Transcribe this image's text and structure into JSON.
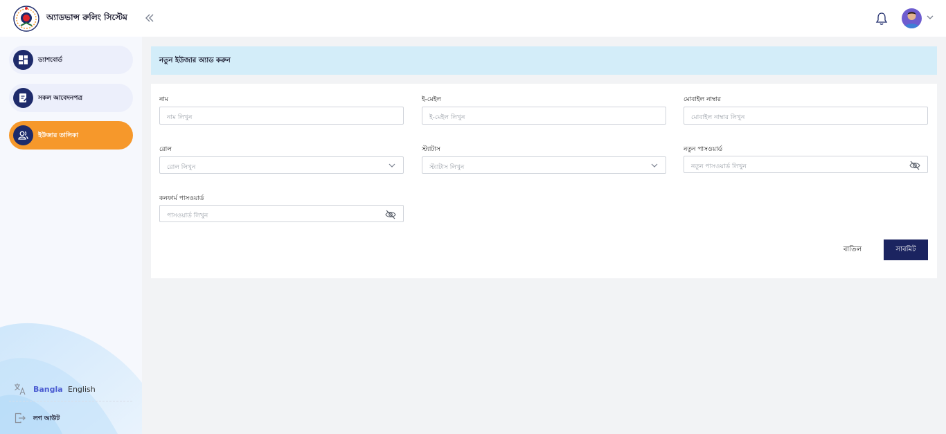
{
  "app": {
    "title": "অ্যাডভান্স রুলিং সিস্টেম"
  },
  "sidebar": {
    "items": [
      {
        "label": "ড্যাশবোর্ড",
        "icon": "dashboard-icon",
        "active": false
      },
      {
        "label": "সকল আবেদনপত্র",
        "icon": "document-edit-icon",
        "active": false
      },
      {
        "label": "ইউজার তালিকা",
        "icon": "users-icon",
        "active": true
      }
    ],
    "language": {
      "bangla": "Bangla",
      "english": "English",
      "selected": "Bangla"
    },
    "logout_label": "লগ আউট"
  },
  "page": {
    "title": "নতুন ইউজার অ্যাড করুন"
  },
  "form": {
    "name": {
      "label": "নাম",
      "placeholder": "নাম  লিখুন"
    },
    "email": {
      "label": "ই-মেইল",
      "placeholder": "ই-মেইল  লিখুন"
    },
    "mobile": {
      "label": "মোবাইল নাম্বার",
      "placeholder": "মোবাইল নাম্বার লিখুন"
    },
    "role": {
      "label": "রোল",
      "placeholder": "রোল লিখুন"
    },
    "status": {
      "label": "স্ট্যাটাস",
      "placeholder": "স্ট্যাটাস লিখুন"
    },
    "new_password": {
      "label": "নতুন পাসওয়ার্ড",
      "placeholder": "নতুন পাসওয়ার্ড লিখুন"
    },
    "confirm_password": {
      "label": "কনফার্ম পাসওয়ার্ড",
      "placeholder": "পাসওয়ার্ড  লিখুন"
    },
    "cancel_label": "বাতিল",
    "submit_label": "সাবমিট"
  },
  "colors": {
    "accent": "#f6982b",
    "primary": "#1b2460",
    "header_bg": "#d3edf9",
    "lang_active": "#4a5bd1"
  }
}
